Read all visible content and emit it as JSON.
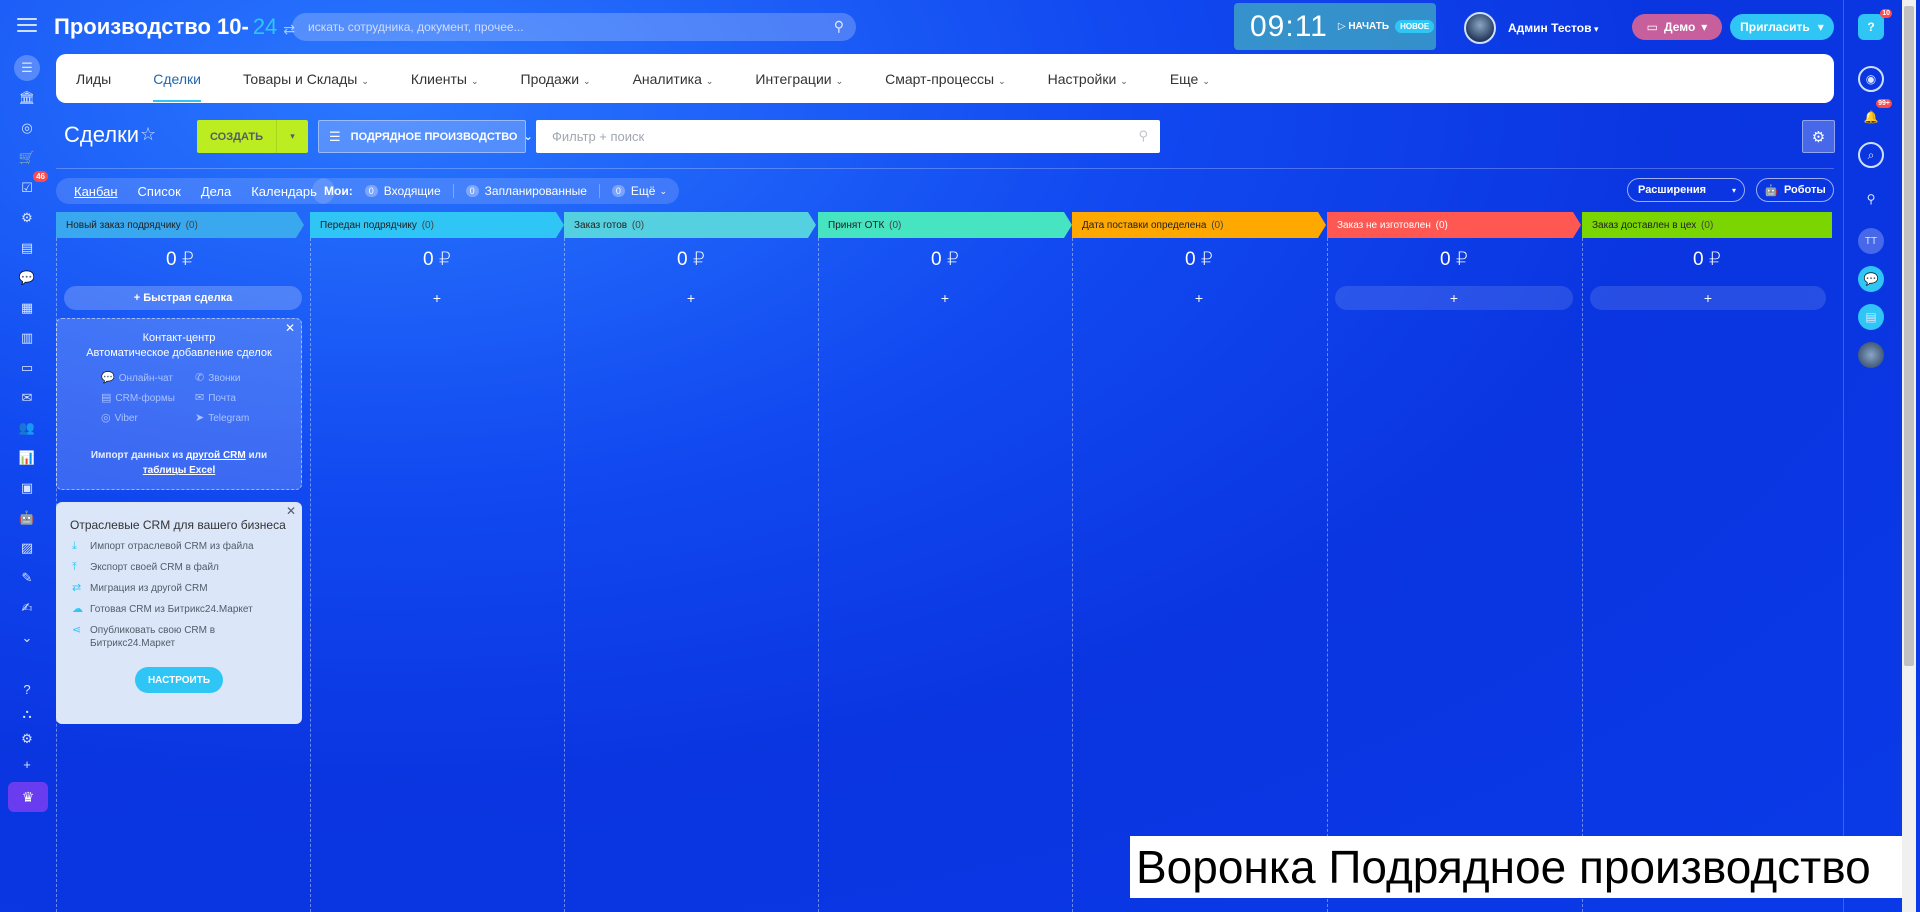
{
  "header": {
    "logo": "Производство 10-",
    "logo_num": "24",
    "search_placeholder": "искать сотрудника, документ, прочее...",
    "clock_time": "09:11",
    "clock_start": "НАЧАТЬ",
    "clock_new": "НОВОЕ",
    "user_name": "Админ Тестов",
    "demo_label": "Демо",
    "invite_label": "Пригласить"
  },
  "left_bar": {
    "tasks_badge": "46"
  },
  "right_bar": {
    "help_badge": "10",
    "notif_badge": "99+",
    "user_initials": "ТТ"
  },
  "nav": {
    "items": [
      {
        "label": "Лиды"
      },
      {
        "label": "Сделки"
      },
      {
        "label": "Товары и Склады"
      },
      {
        "label": "Клиенты"
      },
      {
        "label": "Продажи"
      },
      {
        "label": "Аналитика"
      },
      {
        "label": "Интеграции"
      },
      {
        "label": "Смарт-процессы"
      },
      {
        "label": "Настройки"
      },
      {
        "label": "Еще"
      }
    ]
  },
  "toolbar": {
    "title": "Сделки",
    "create_label": "СОЗДАТЬ",
    "funnel_label": "ПОДРЯДНОЕ ПРОИЗВОДСТВО",
    "filter_placeholder": "Фильтр + поиск"
  },
  "views": {
    "items": [
      "Канбан",
      "Список",
      "Дела",
      "Календарь"
    ],
    "my_label": "Мои:",
    "incoming_count": "0",
    "incoming_label": "Входящие",
    "planned_count": "0",
    "planned_label": "Запланированные",
    "more_count": "0",
    "more_label": "Ещё",
    "extensions_label": "Расширения",
    "robots_label": "Роботы"
  },
  "columns": [
    {
      "title": "Новый заказ подрядчику",
      "count": "(0)",
      "sum": "0 ₽",
      "color": "#39a8ef",
      "add": "+ Быстрая сделка"
    },
    {
      "title": "Передан подрядчику",
      "count": "(0)",
      "sum": "0 ₽",
      "color": "#2fc6f6",
      "add": "+"
    },
    {
      "title": "Заказ готов",
      "count": "(0)",
      "sum": "0 ₽",
      "color": "#55d0e0",
      "add": "+"
    },
    {
      "title": "Принят ОТК",
      "count": "(0)",
      "sum": "0 ₽",
      "color": "#47e4c2",
      "add": "+"
    },
    {
      "title": "Дата поставки определена",
      "count": "(0)",
      "sum": "0 ₽",
      "color": "#ffa900",
      "add": "+"
    },
    {
      "title": "Заказ не изготовлен",
      "count": "(0)",
      "sum": "0 ₽",
      "color": "#ff5752",
      "add": "+"
    },
    {
      "title": "Заказ доставлен в цех",
      "count": "(0)",
      "sum": "0 ₽",
      "color": "#7bd500",
      "add": "+"
    }
  ],
  "contact_center": {
    "title1": "Контакт-центр",
    "title2": "Автоматическое добавление сделок",
    "items": [
      "Онлайн-чат",
      "Звонки",
      "CRM-формы",
      "Почта",
      "Viber",
      "Telegram"
    ],
    "import_text": "Импорт данных из",
    "import_link1": "другой CRM",
    "import_or": "или",
    "import_link2": "таблицы Excel"
  },
  "industry": {
    "title": "Отраслевые CRM для вашего бизнеса",
    "items": [
      "Импорт отраслевой CRM из файла",
      "Экспорт своей CRM в файл",
      "Миграция из другой CRM",
      "Готовая CRM из Битрикс24.Маркет",
      "Опубликовать свою CRM в Битрикс24.Маркет"
    ],
    "button": "НАСТРОИТЬ"
  },
  "caption": "Воронка Подрядное производство"
}
